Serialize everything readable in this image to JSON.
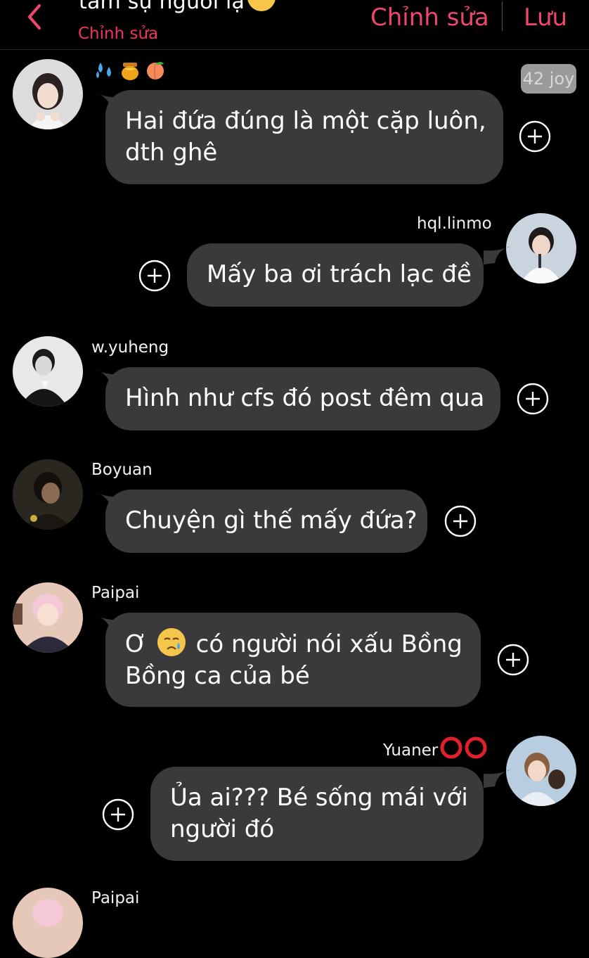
{
  "header": {
    "title": "tâm sự người lạ",
    "title_emoji": "relieved-face-emoji",
    "subtitle": "Chỉnh sửa",
    "edit_label": "Chỉnh sửa",
    "save_label": "Lưu",
    "back_icon": "chevron-left-icon",
    "accent_color": "#f0456f"
  },
  "messages": [
    {
      "sender": "",
      "sender_emojis": [
        "sweat-droplets-emoji",
        "honey-pot-emoji",
        "peach-emoji"
      ],
      "badge": "42 joy",
      "line1": "Hai đứa đúng là một cặp luôn,",
      "line2": "dth ghê",
      "side": "left"
    },
    {
      "sender": "hql.linmo",
      "line1": "Mấy ba ơi trách lạc đề",
      "side": "right"
    },
    {
      "sender": "w.yuheng",
      "line1": "Hình như cfs đó post đêm qua",
      "side": "left"
    },
    {
      "sender": "Boyuan",
      "line1": "Chuyện gì thế mấy đứa?",
      "side": "left"
    },
    {
      "sender": "Paipai",
      "line1_pre": "Ơ",
      "line1_emoji": "crying-face-emoji",
      "line1_post": "có người nói xấu Bồng",
      "line2": "Bồng ca của bé",
      "side": "left"
    },
    {
      "sender": "Yuaner",
      "sender_suffix": "double-red-circle-emoji",
      "line1": "Ủa ai??? Bé sống mái với",
      "line2": "người đó",
      "side": "right"
    },
    {
      "sender": "Paipai",
      "side": "left"
    }
  ],
  "colors": {
    "background": "#000000",
    "bubble": "#3a3a3c",
    "text": "#ffffff"
  }
}
